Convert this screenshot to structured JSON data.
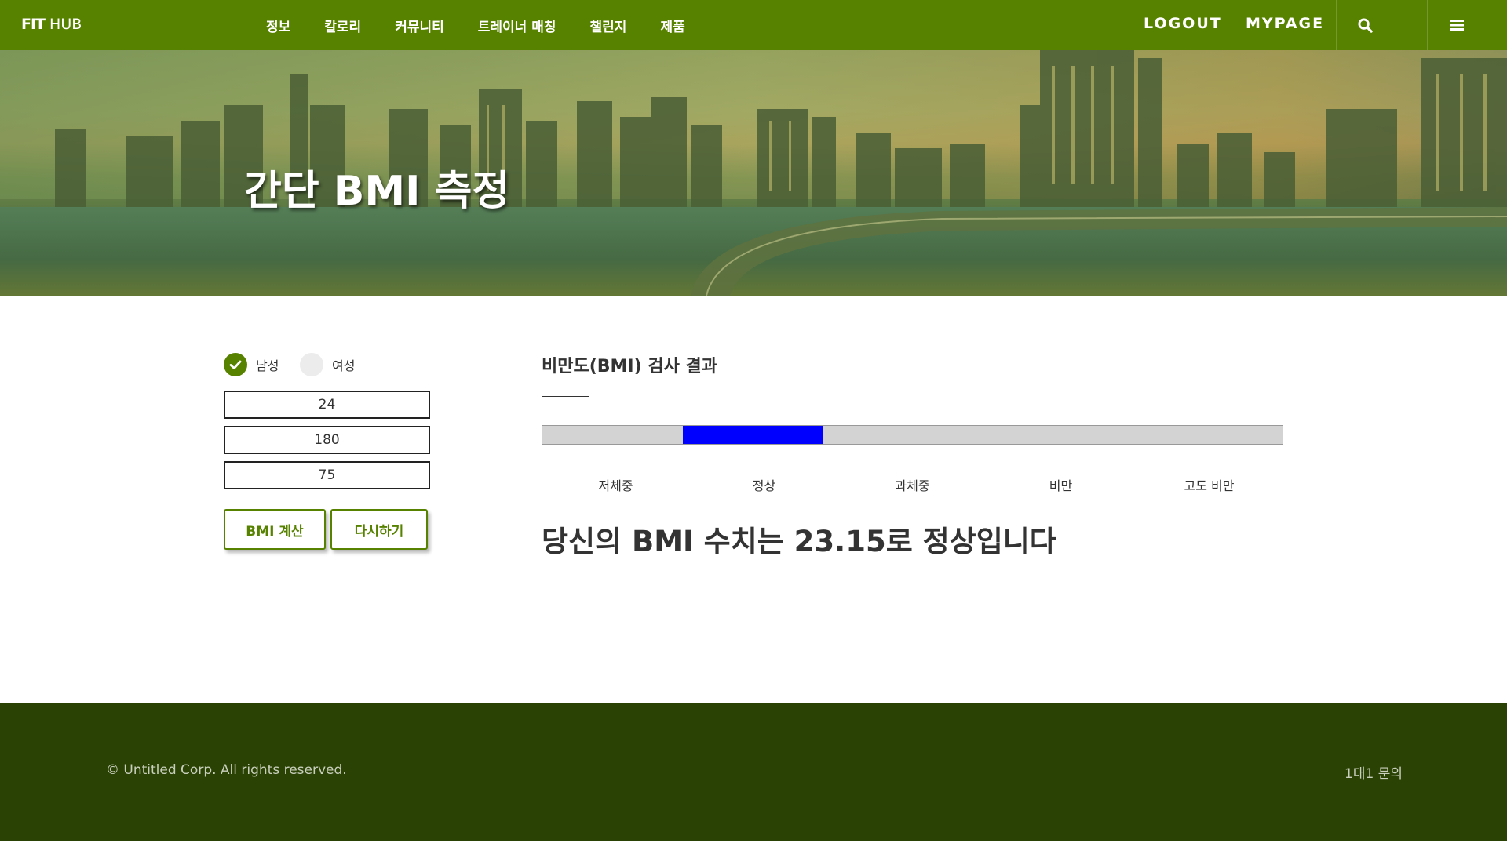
{
  "navbar": {
    "brand_bold": "FIT",
    "brand_rest": " HUB",
    "menu": [
      {
        "label": "정보"
      },
      {
        "label": "칼로리"
      },
      {
        "label": "커뮤니티"
      },
      {
        "label": "트레이너 매칭"
      },
      {
        "label": "챌린지"
      },
      {
        "label": "제품"
      }
    ],
    "logout_label": "LOGOUT",
    "mypage_label": "MYPAGE",
    "search_icon": "search-icon",
    "menu_icon": "hamburger-menu-icon",
    "background_color": "#578200"
  },
  "hero": {
    "title": "간단 BMI 측정"
  },
  "form": {
    "gender": {
      "male_label": "남성",
      "female_label": "여성",
      "selected": "남성"
    },
    "age_value": "24",
    "height_value": "180",
    "weight_value": "75",
    "calc_button": "BMI 계산",
    "reset_button": "다시하기"
  },
  "result": {
    "title": "비만도(BMI) 검사 결과",
    "categories": [
      "저체중",
      "정상",
      "과체중",
      "비만",
      "고도 비만"
    ],
    "active_category_index": 1,
    "bar_fill_color": "#0000ff",
    "bar_bg_color": "#d3d3d3",
    "message": "당신의 BMI 수치는 23.15로 정상입니다"
  },
  "footer": {
    "copyright": "© Untitled Corp. All rights reserved.",
    "inquiry": "1대1 문의",
    "background_color": "#2a4304"
  }
}
